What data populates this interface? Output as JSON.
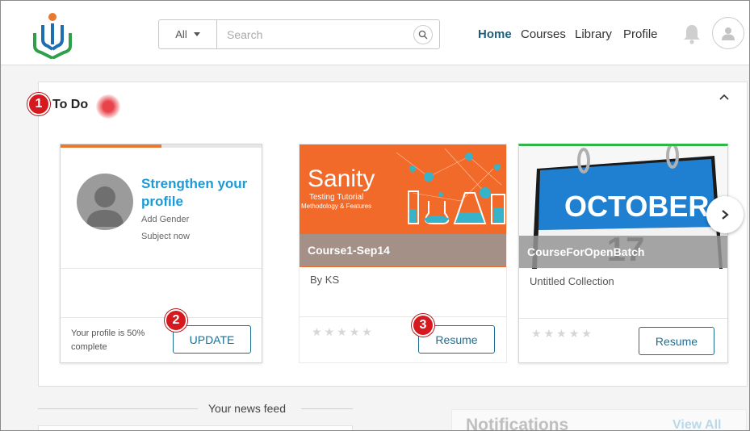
{
  "header": {
    "search": {
      "category": "All",
      "placeholder": "Search"
    },
    "nav": [
      "Home",
      "Courses",
      "Library",
      "Profile"
    ]
  },
  "todo": {
    "title": "To Do",
    "badges": [
      "1",
      "2",
      "3"
    ],
    "profile_card": {
      "title": "Strengthen your profile",
      "items": [
        "Add Gender",
        "Subject now"
      ],
      "completion_text": "Your profile is 50% complete",
      "completion_percent": 50,
      "button": "UPDATE"
    },
    "courses": [
      {
        "name": "Course1-Sep14",
        "by": "By KS",
        "button": "Resume",
        "rating": 0,
        "thumb_text": "Sanity",
        "thumb_sub1": "Testing Tutorial",
        "thumb_sub2": "Methodology & Features"
      },
      {
        "name": "CourseForOpenBatch",
        "by": "Untitled Collection",
        "button": "Resume",
        "rating": 0,
        "thumb_text": "OCTOBER",
        "thumb_day": "17"
      }
    ]
  },
  "feed": {
    "label": "Your news feed"
  },
  "notifications": {
    "title": "Notifications",
    "view_all": "View All"
  },
  "colors": {
    "accent": "#1a9ad6",
    "button": "#1a6f93",
    "badge": "#d6191f",
    "progress": "#e8792f",
    "green": "#2fb54a"
  }
}
